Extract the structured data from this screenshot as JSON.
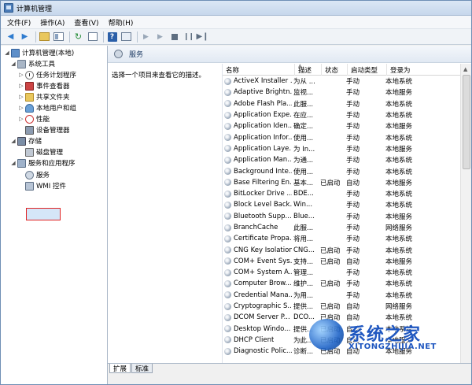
{
  "window": {
    "title": "计算机管理"
  },
  "menu": [
    "文件(F)",
    "操作(A)",
    "查看(V)",
    "帮助(H)"
  ],
  "tree": {
    "root": "计算机管理(本地)",
    "system_tools": "系统工具",
    "task_scheduler": "任务计划程序",
    "event_viewer": "事件查看器",
    "shared_folders": "共享文件夹",
    "local_users": "本地用户和组",
    "performance": "性能",
    "device_manager": "设备管理器",
    "storage": "存储",
    "disk_management": "磁盘管理",
    "services_apps": "服务和应用程序",
    "services": "服务",
    "wmi": "WMI 控件"
  },
  "main": {
    "header_title": "服务",
    "description_prompt": "选择一个项目来查看它的描述。",
    "columns": [
      "名称",
      "描述",
      "状态",
      "启动类型",
      "登录为"
    ],
    "rows": [
      [
        "ActiveX Installer ...",
        "为从 ...",
        "",
        "手动",
        "本地系统"
      ],
      [
        "Adaptive Brightn...",
        "监视...",
        "",
        "手动",
        "本地服务"
      ],
      [
        "Adobe Flash Pla...",
        "此服...",
        "",
        "手动",
        "本地系统"
      ],
      [
        "Application Expe...",
        "在应...",
        "",
        "手动",
        "本地系统"
      ],
      [
        "Application Iden...",
        "确定...",
        "",
        "手动",
        "本地服务"
      ],
      [
        "Application Infor...",
        "使用...",
        "",
        "手动",
        "本地系统"
      ],
      [
        "Application Laye...",
        "为 In...",
        "",
        "手动",
        "本地服务"
      ],
      [
        "Application Man...",
        "为通...",
        "",
        "手动",
        "本地系统"
      ],
      [
        "Background Inte...",
        "使用...",
        "",
        "手动",
        "本地系统"
      ],
      [
        "Base Filtering En...",
        "基本...",
        "已启动",
        "自动",
        "本地服务"
      ],
      [
        "BitLocker Drive ...",
        "BDE...",
        "",
        "手动",
        "本地系统"
      ],
      [
        "Block Level Back...",
        "Win...",
        "",
        "手动",
        "本地系统"
      ],
      [
        "Bluetooth Supp...",
        "Blue...",
        "",
        "手动",
        "本地服务"
      ],
      [
        "BranchCache",
        "此服...",
        "",
        "手动",
        "网络服务"
      ],
      [
        "Certificate Propa...",
        "将用...",
        "",
        "手动",
        "本地系统"
      ],
      [
        "CNG Key Isolation",
        "CNG...",
        "已启动",
        "手动",
        "本地系统"
      ],
      [
        "COM+ Event Sys...",
        "支持...",
        "已启动",
        "自动",
        "本地服务"
      ],
      [
        "COM+ System A...",
        "管理...",
        "",
        "手动",
        "本地系统"
      ],
      [
        "Computer Brow...",
        "维护...",
        "已启动",
        "手动",
        "本地系统"
      ],
      [
        "Credential Mana...",
        "为用...",
        "",
        "手动",
        "本地系统"
      ],
      [
        "Cryptographic S...",
        "提供...",
        "已启动",
        "自动",
        "网络服务"
      ],
      [
        "DCOM Server P...",
        "DCO...",
        "已启动",
        "自动",
        "本地系统"
      ],
      [
        "Desktop Windo...",
        "提供...",
        "已启动",
        "自动",
        "本地系统"
      ],
      [
        "DHCP Client",
        "为此...",
        "已启动",
        "自动",
        "本地服务"
      ],
      [
        "Diagnostic Polic...",
        "诊断...",
        "已启动",
        "自动",
        "本地服务"
      ]
    ]
  },
  "tabs": [
    "扩展",
    "标准"
  ],
  "watermark": {
    "main": "系统之家",
    "sub": "XITONGZHIJIA.NET"
  },
  "colors": {
    "selection_border": "#e02424",
    "header_text": "#1c3a63",
    "watermark": "#1f57c0"
  }
}
